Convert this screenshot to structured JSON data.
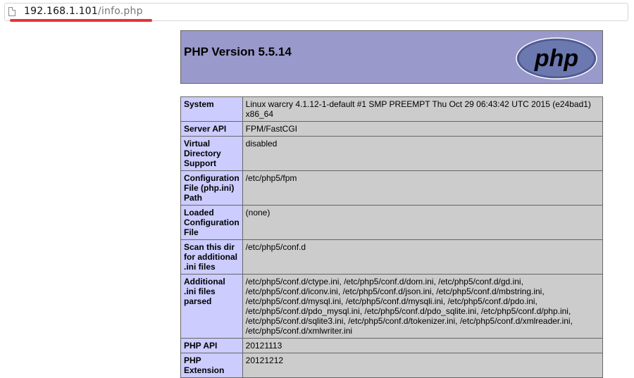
{
  "browser": {
    "url_host": "192.168.1.101",
    "url_path": "/info.php"
  },
  "header": {
    "title": "PHP Version 5.5.14",
    "logo_text": "php"
  },
  "rows": [
    {
      "key": "System",
      "value": "Linux warcry 4.1.12-1-default #1 SMP PREEMPT Thu Oct 29 06:43:42 UTC 2015 (e24bad1) x86_64"
    },
    {
      "key": "Server API",
      "value": "FPM/FastCGI"
    },
    {
      "key": "Virtual Directory Support",
      "value": "disabled"
    },
    {
      "key": "Configuration File (php.ini) Path",
      "value": "/etc/php5/fpm"
    },
    {
      "key": "Loaded Configuration File",
      "value": "(none)"
    },
    {
      "key": "Scan this dir for additional .ini files",
      "value": "/etc/php5/conf.d"
    },
    {
      "key": "Additional .ini files parsed",
      "value": "/etc/php5/conf.d/ctype.ini, /etc/php5/conf.d/dom.ini, /etc/php5/conf.d/gd.ini, /etc/php5/conf.d/iconv.ini, /etc/php5/conf.d/json.ini, /etc/php5/conf.d/mbstring.ini, /etc/php5/conf.d/mysql.ini, /etc/php5/conf.d/mysqli.ini, /etc/php5/conf.d/pdo.ini, /etc/php5/conf.d/pdo_mysql.ini, /etc/php5/conf.d/pdo_sqlite.ini, /etc/php5/conf.d/php.ini, /etc/php5/conf.d/sqlite3.ini, /etc/php5/conf.d/tokenizer.ini, /etc/php5/conf.d/xmlreader.ini, /etc/php5/conf.d/xmlwriter.ini"
    },
    {
      "key": "PHP API",
      "value": "20121113"
    },
    {
      "key": "PHP Extension",
      "value": "20121212"
    }
  ],
  "colors": {
    "header_bg": "#9999cc",
    "key_bg": "#ccccff",
    "value_bg": "#cccccc",
    "url_underline": "#e8333a"
  }
}
